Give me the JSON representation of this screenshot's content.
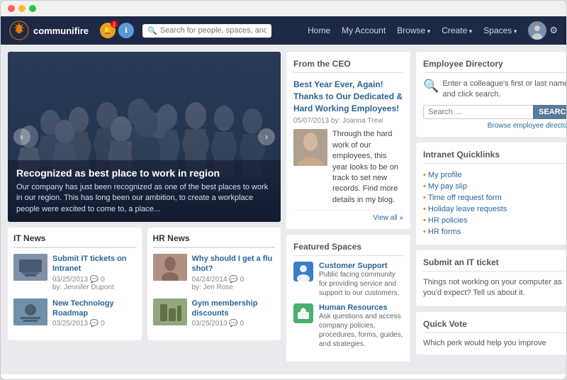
{
  "browser": {
    "chrome_buttons": [
      "red",
      "yellow",
      "green"
    ]
  },
  "topnav": {
    "logo_text": "communifire",
    "search_placeholder": "Search for people, spaces, and content",
    "nav_items": [
      {
        "label": "Home",
        "has_arrow": false
      },
      {
        "label": "My Account",
        "has_arrow": false
      },
      {
        "label": "Browse",
        "has_arrow": true
      },
      {
        "label": "Create",
        "has_arrow": true
      },
      {
        "label": "Spaces",
        "has_arrow": true
      }
    ]
  },
  "hero": {
    "title": "Recognized as best place to work in region",
    "subtitle": "Our company has just been recognized as one of the best places to work in our region. This has long been our ambition, to create a workplace people were excited to come to, a place..."
  },
  "ceo_section": {
    "widget_title": "From the CEO",
    "post_title": "Best Year Ever, Again! Thanks to Our Dedicated & Hard Working Employees!",
    "meta": "05/07/2013   by: Joanna Trew",
    "body_text": "Through the hard work of our employees, this year looks to be on track to set new records. Find more details in my blog.",
    "view_all": "View all »"
  },
  "featured_spaces": {
    "widget_title": "Featured Spaces",
    "spaces": [
      {
        "name": "Customer Support",
        "desc": "Public facing community for providing service and support to our customers.",
        "icon": "CS",
        "color": "blue"
      },
      {
        "name": "Human Resources",
        "desc": "Ask questions and access company policies, procedures, forms, guides, and strategies.",
        "icon": "HR",
        "color": "green"
      }
    ]
  },
  "employee_directory": {
    "widget_title": "Employee Directory",
    "description": "Enter a colleague's first or last name and click search.",
    "search_placeholder": "Search ...",
    "search_btn": "SEARCH",
    "browse_link": "Browse employee directory ›"
  },
  "intranet_quicklinks": {
    "widget_title": "Intranet Quicklinks",
    "links": [
      "My profile",
      "My pay slip",
      "Time off request form",
      "Holiday leave requests",
      "HR policies",
      "HR forms"
    ]
  },
  "submit_it": {
    "widget_title": "Submit an IT ticket",
    "text": "Things not working on your computer as you'd expect? Tell us about it."
  },
  "quick_vote": {
    "widget_title": "Quick Vote",
    "text": "Which perk would help you improve"
  },
  "it_news": {
    "title": "IT News",
    "items": [
      {
        "title": "Submit IT tickets on Intranet",
        "date": "03/25/2013",
        "comments": "0",
        "author": "by: Jennifer Dupont"
      },
      {
        "title": "New Technology Roadmap",
        "date": "03/25/2013",
        "comments": "0",
        "author": ""
      }
    ]
  },
  "hr_news": {
    "title": "HR News",
    "items": [
      {
        "title": "Why should I get a flu shot?",
        "date": "04/24/2014",
        "comments": "0",
        "author": "by: Jen Rose"
      },
      {
        "title": "Gym membership discounts",
        "date": "03/25/2013",
        "comments": "0",
        "author": ""
      }
    ]
  }
}
